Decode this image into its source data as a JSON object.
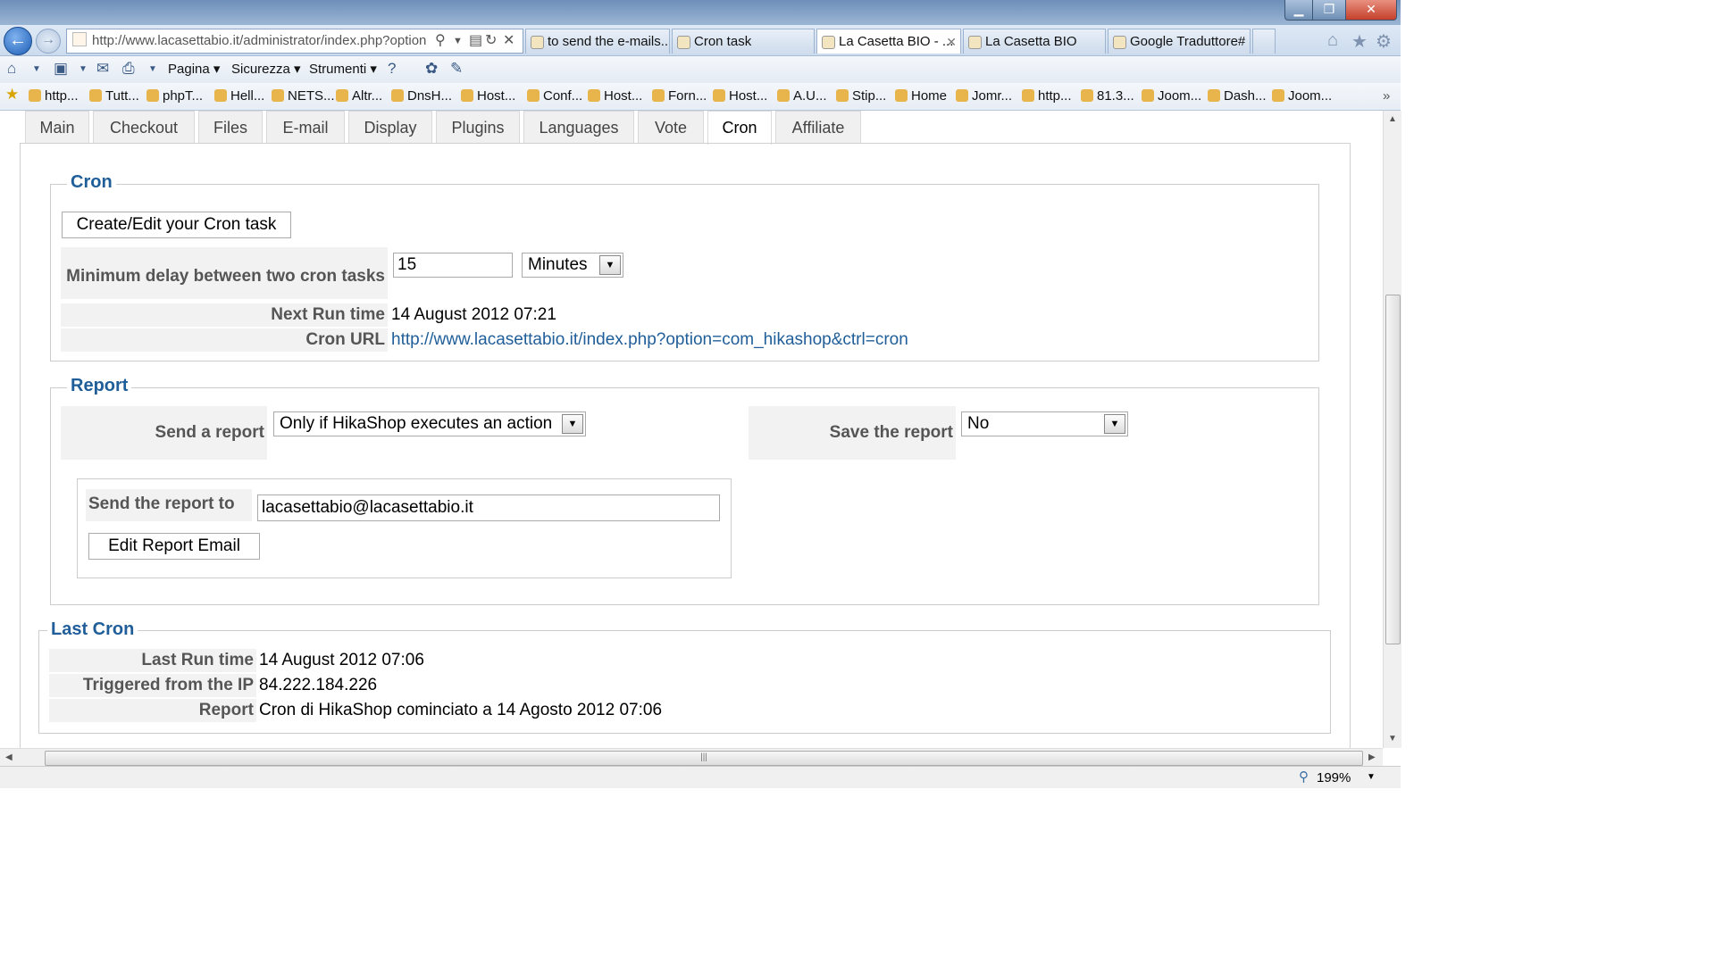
{
  "browser": {
    "address": "http://www.lacasettabio.it/administrator/index.php?option",
    "tabs": [
      {
        "label": "to send the e-mails..."
      },
      {
        "label": "Cron task"
      },
      {
        "label": "La Casetta BIO - ..."
      },
      {
        "label": "La Casetta BIO"
      },
      {
        "label": "Google Traduttore#"
      }
    ],
    "menu": {
      "page": "Pagina",
      "security": "Sicurezza",
      "tools": "Strumenti"
    },
    "favorites": [
      "http...",
      "Tutt...",
      "phpT...",
      "Hell...",
      "NETS...",
      "Altr...",
      "DnsH...",
      "Host...",
      "Conf...",
      "Host...",
      "Forn...",
      "Host...",
      "A.U...",
      "Stip...",
      "Home",
      "Jomr...",
      "http...",
      "81.3...",
      "Joom...",
      "Dash...",
      "Joom..."
    ],
    "zoom": "199%"
  },
  "config_tabs": [
    "Main",
    "Checkout",
    "Files",
    "E-mail",
    "Display",
    "Plugins",
    "Languages",
    "Vote",
    "Cron",
    "Affiliate"
  ],
  "active_tab": "Cron",
  "cron": {
    "legend": "Cron",
    "edit_button": "Create/Edit your Cron task",
    "min_delay_label": "Minimum delay between two cron tasks",
    "min_delay_value": "15",
    "min_delay_unit": "Minutes",
    "next_run_label": "Next Run time",
    "next_run_value": "14 August 2012 07:21",
    "url_label": "Cron URL",
    "url_value": "http://www.lacasettabio.it/index.php?option=com_hikashop&ctrl=cron"
  },
  "report": {
    "legend": "Report",
    "send_label": "Send a report",
    "send_value": "Only if HikaShop executes an action",
    "save_label": "Save the report",
    "save_value": "No",
    "send_to_label": "Send the report to",
    "send_to_value": "lacasettabio@lacasettabio.it",
    "edit_email_button": "Edit Report Email"
  },
  "last_cron": {
    "legend": "Last Cron",
    "last_run_label": "Last Run time",
    "last_run_value": "14 August 2012 07:06",
    "ip_label": "Triggered from the IP",
    "ip_value": "84.222.184.226",
    "report_label": "Report",
    "report_value": "Cron di HikaShop cominciato a 14 Agosto 2012 07:06"
  }
}
